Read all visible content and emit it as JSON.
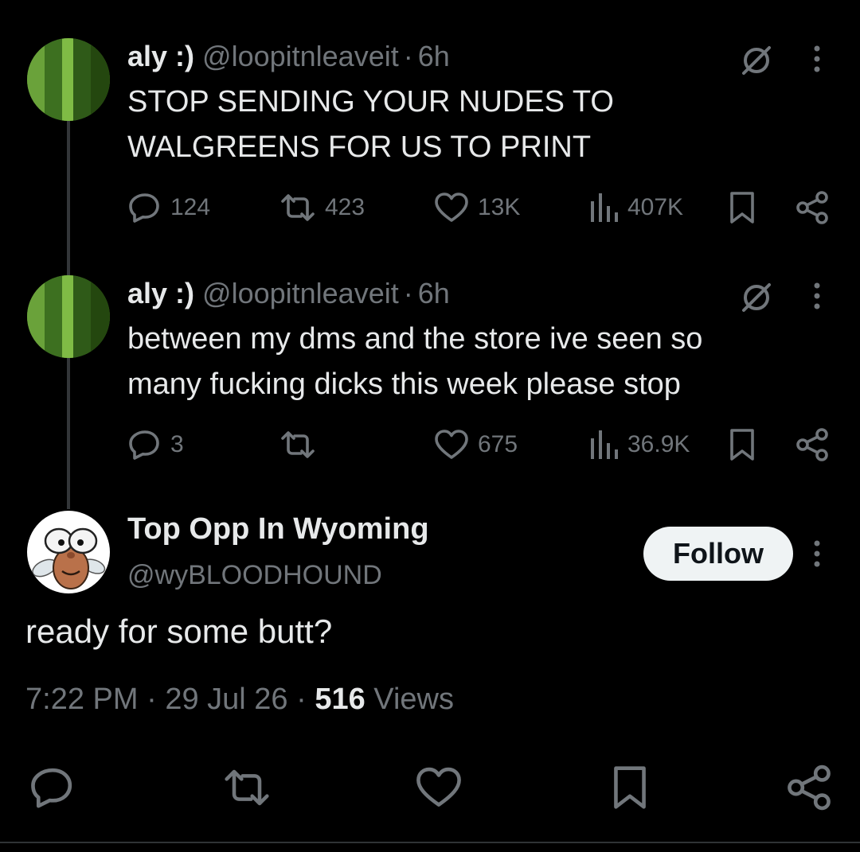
{
  "thread": [
    {
      "name": "aly :)",
      "handle": "@loopitnleaveit",
      "separator": "·",
      "time": "6h",
      "text_lines": [
        "STOP SENDING YOUR NUDES TO",
        "WALGREENS FOR US TO PRINT"
      ],
      "stats": {
        "replies": "124",
        "reposts": "423",
        "likes": "13K",
        "views": "407K"
      }
    },
    {
      "name": "aly :)",
      "handle": "@loopitnleaveit",
      "separator": "·",
      "time": "6h",
      "text_lines": [
        "between my dms and the store ive seen so",
        "many fucking dicks this week please stop"
      ],
      "stats": {
        "replies": "3",
        "reposts": "",
        "likes": "675",
        "views": "36.9K"
      }
    }
  ],
  "main": {
    "name": "Top Opp In Wyoming",
    "handle": "@wyBLOODHOUND",
    "follow_label": "Follow",
    "text": "ready for some butt?",
    "time": "7:22 PM",
    "separator": "·",
    "date": "29 Jul 26",
    "views_count": "516",
    "views_label": "Views"
  },
  "icons": {
    "reply": "reply-icon",
    "repost": "repost-icon",
    "like": "like-icon",
    "views": "views-icon",
    "bookmark": "bookmark-icon",
    "share": "share-icon",
    "grok": "grok-icon",
    "more": "more-icon"
  },
  "colors": {
    "background": "#000000",
    "primary_text": "#e7e9ea",
    "secondary_text": "#71767b",
    "follow_button": "#eff3f4",
    "thread_line": "#333639"
  }
}
